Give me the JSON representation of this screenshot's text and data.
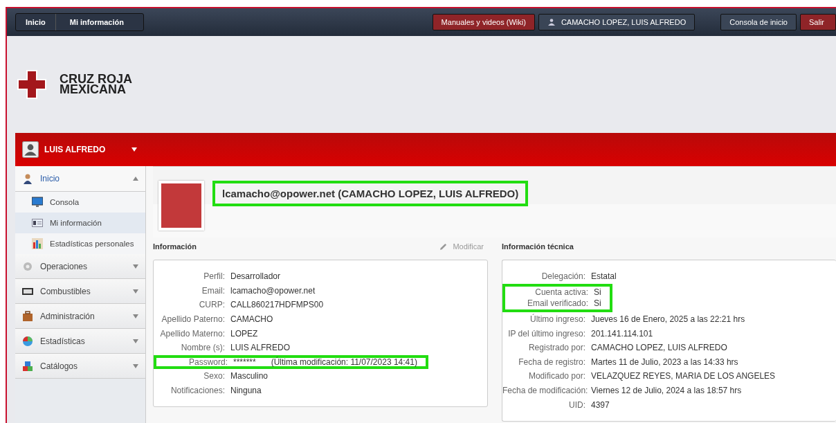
{
  "breadcrumb": [
    {
      "label": "Inicio"
    },
    {
      "label": "Mi información"
    }
  ],
  "top_buttons": [
    {
      "label": "Manuales y videos (Wiki)",
      "kind": "wiki"
    },
    {
      "label": "CAMACHO LOPEZ, LUIS ALFREDO",
      "kind": "user"
    },
    {
      "label": "Consola de inicio",
      "kind": "plain"
    },
    {
      "label": "Salir",
      "kind": "exit"
    }
  ],
  "logo": {
    "line1": "CRUZ ROJA",
    "line2": "MEXICANA"
  },
  "user_menu": {
    "name": "LUIS ALFREDO"
  },
  "sidebar": {
    "items": [
      {
        "label": "Inicio",
        "kind": "person",
        "expanded": true,
        "children": [
          {
            "label": "Consola",
            "kind": "monitor",
            "selected": false
          },
          {
            "label": "Mi información",
            "kind": "card",
            "selected": true
          },
          {
            "label": "Estadísticas personales",
            "kind": "bars",
            "selected": false
          }
        ]
      },
      {
        "label": "Operaciones",
        "kind": "gear",
        "expanded": false
      },
      {
        "label": "Combustibles",
        "kind": "counter",
        "expanded": false
      },
      {
        "label": "Administración",
        "kind": "briefcase",
        "expanded": false
      },
      {
        "label": "Estadísticas",
        "kind": "pie",
        "expanded": false
      },
      {
        "label": "Catálogos",
        "kind": "blocks",
        "expanded": false
      }
    ]
  },
  "profile": {
    "title": "lcamacho@opower.net (CAMACHO LOPEZ, LUIS ALFREDO)",
    "highlighted": true
  },
  "info": {
    "title": "Información",
    "action": "Modificar",
    "rows": [
      {
        "label": "Perfil:",
        "value": "Desarrollador",
        "highlighted": false
      },
      {
        "label": "Email:",
        "value": "lcamacho@opower.net",
        "highlighted": false
      },
      {
        "label": "CURP:",
        "value": "CALL860217HDFMPS00",
        "highlighted": false
      },
      {
        "label": "Apellido Paterno:",
        "value": "CAMACHO",
        "highlighted": false
      },
      {
        "label": "Apellido Materno:",
        "value": "LOPEZ",
        "highlighted": false
      },
      {
        "label": "Nombre (s):",
        "value": "LUIS ALFREDO",
        "highlighted": false
      },
      {
        "label": "Password:",
        "value": "*******",
        "note": "(Última modificación: 11/07/2023 14:41)",
        "highlighted": true
      },
      {
        "label": "Sexo:",
        "value": "Masculino",
        "highlighted": false
      },
      {
        "label": "Notificaciones:",
        "value": "Ninguna",
        "highlighted": false
      }
    ]
  },
  "tech": {
    "title": "Información técnica",
    "rows": [
      {
        "label": "Delegación:",
        "value": "Estatal",
        "highlighted": false
      },
      {
        "label": "Cuenta activa:",
        "value": "Si",
        "highlighted": true
      },
      {
        "label": "Email verificado:",
        "value": "Si",
        "highlighted": true
      },
      {
        "label": "Último ingreso:",
        "value": "Jueves 16 de Enero, 2025 a las 22:21 hrs",
        "highlighted": false
      },
      {
        "label": "IP del último ingreso:",
        "value": "201.141.114.101",
        "highlighted": false
      },
      {
        "label": "Registrado por:",
        "value": "CAMACHO LOPEZ, LUIS ALFREDO",
        "highlighted": false
      },
      {
        "label": "Fecha de registro:",
        "value": "Martes 11 de Julio, 2023 a las 14:33 hrs",
        "highlighted": false
      },
      {
        "label": "Modificado por:",
        "value": "VELAZQUEZ REYES, MARIA DE LOS ANGELES",
        "highlighted": false
      },
      {
        "label": "Fecha de modificación:",
        "value": "Viernes 12 de Julio, 2024 a las 18:57 hrs",
        "highlighted": false
      },
      {
        "label": "UID:",
        "value": "4397",
        "highlighted": false
      }
    ]
  }
}
